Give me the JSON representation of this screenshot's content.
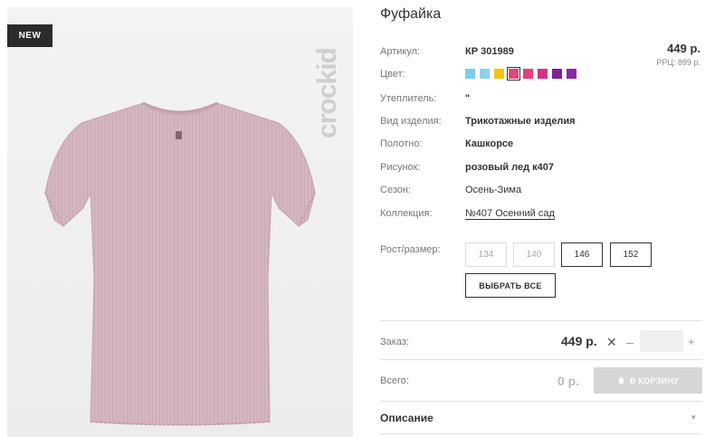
{
  "badge": "NEW",
  "brand": "crockid",
  "title": "Фуфайка",
  "details": {
    "article_label": "Артикул:",
    "article_value": "КР 301989",
    "color_label": "Цвет:",
    "insulation_label": "Утеплитель:",
    "insulation_value": "\"",
    "type_label": "Вид изделия:",
    "type_value": "Трикотажные изделия",
    "fabric_label": "Полотно:",
    "fabric_value": "Кашкорсе",
    "print_label": "Рисунок:",
    "print_value": "розовый лед к407",
    "season_label": "Сезон:",
    "season_value": "Осень-Зима",
    "collection_label": "Коллекция:",
    "collection_value": "№407 Осенний сад"
  },
  "price": {
    "main": "449 р.",
    "rrc": "РРЦ: 899 р."
  },
  "colors": [
    {
      "name": "light-blue",
      "hex": "#7fc8f0"
    },
    {
      "name": "sky-blue",
      "hex": "#8fd0ee"
    },
    {
      "name": "yellow",
      "hex": "#f2c413"
    },
    {
      "name": "pink",
      "hex": "#e8457c",
      "selected": true
    },
    {
      "name": "magenta",
      "hex": "#e83e7a"
    },
    {
      "name": "fuchsia",
      "hex": "#d13486"
    },
    {
      "name": "purple",
      "hex": "#7b2396"
    },
    {
      "name": "violet",
      "hex": "#8a2aa0"
    }
  ],
  "sizes": {
    "label": "Рост/размер:",
    "options": [
      {
        "value": "134",
        "available": false
      },
      {
        "value": "140",
        "available": false
      },
      {
        "value": "146",
        "available": true
      },
      {
        "value": "152",
        "available": true
      }
    ],
    "select_all": "ВЫБРАТЬ ВСЕ"
  },
  "order": {
    "label": "Заказ:",
    "price": "449 р.",
    "times": "✕",
    "minus": "–",
    "qty": "",
    "plus": "+"
  },
  "total": {
    "label": "Всего:",
    "value": "0 р.",
    "cart_button": "В КОРЗИНУ"
  },
  "description": {
    "title": "Описание",
    "chevron": "▾"
  }
}
